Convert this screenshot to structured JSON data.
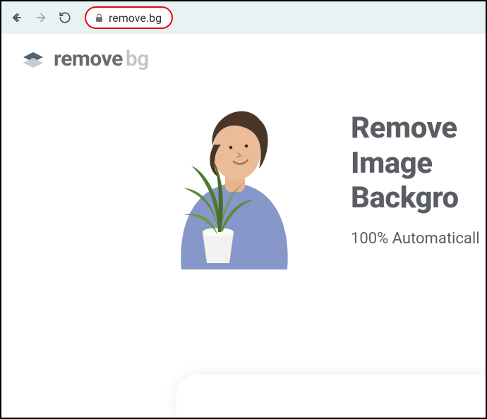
{
  "browser": {
    "url": "remove.bg"
  },
  "logo": {
    "text1": "remove",
    "text2": "bg"
  },
  "hero": {
    "line1": "Remove",
    "line2": "Image",
    "line3": "Backgro",
    "subtitle": "100% Automaticall"
  }
}
